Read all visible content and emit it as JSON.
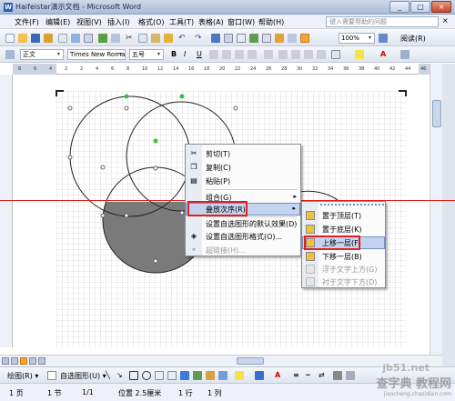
{
  "window": {
    "title": "Haifeistar演示文档 - Microsoft Word",
    "minimize": "_",
    "maximize": "□",
    "close": "×"
  },
  "menubar": {
    "items": [
      "文件(F)",
      "编辑(E)",
      "视图(V)",
      "插入(I)",
      "格式(O)",
      "工具(T)",
      "表格(A)",
      "窗口(W)",
      "帮助(H)"
    ],
    "help_placeholder": "键入需要帮助的问题"
  },
  "standard_toolbar": {
    "zoom": "100%",
    "read_label": "阅读(R)"
  },
  "formatting_toolbar": {
    "style": "正文",
    "font": "Times New Roman",
    "size": "五号"
  },
  "ruler_ticks": [
    "8",
    "6",
    "4",
    "2",
    "2",
    "4",
    "6",
    "8",
    "10",
    "12",
    "14",
    "16",
    "18",
    "20",
    "22",
    "24",
    "26",
    "28",
    "30",
    "32",
    "34",
    "36",
    "38",
    "40",
    "42",
    "44",
    "46"
  ],
  "context_menu": {
    "items": [
      {
        "label": "剪切(T)",
        "icon": "scissors-icon",
        "glyph": "✂",
        "disabled": false
      },
      {
        "label": "复制(C)",
        "icon": "copy-icon",
        "glyph": "❐",
        "disabled": false
      },
      {
        "label": "粘贴(P)",
        "icon": "paste-icon",
        "glyph": "▤",
        "disabled": false
      },
      {
        "label": "组合(G)",
        "icon": "",
        "glyph": "",
        "disabled": false,
        "submenu": "▸"
      },
      {
        "label": "叠放次序(R)",
        "icon": "",
        "glyph": "",
        "disabled": false,
        "submenu": "▸",
        "highlighted": true
      },
      {
        "label": "设置自选图形的默认效果(D)",
        "icon": "",
        "glyph": "",
        "disabled": false
      },
      {
        "label": "设置自选图形格式(O)...",
        "icon": "format-shape-icon",
        "glyph": "◈",
        "disabled": false
      },
      {
        "label": "超链接(H)...",
        "icon": "hyperlink-icon",
        "glyph": "⚭",
        "disabled": true
      }
    ]
  },
  "order_submenu": {
    "items": [
      {
        "label": "置于顶层(T)",
        "icon": "bring-to-front-icon",
        "disabled": false
      },
      {
        "label": "置于底层(K)",
        "icon": "send-to-back-icon",
        "disabled": false
      },
      {
        "label": "上移一层(F)",
        "icon": "bring-forward-icon",
        "disabled": false,
        "highlighted": true
      },
      {
        "label": "下移一层(B)",
        "icon": "send-backward-icon",
        "disabled": false
      },
      {
        "label": "浮于文字上方(G)",
        "icon": "in-front-of-text-icon",
        "disabled": true
      },
      {
        "label": "衬于文字下方(D)",
        "icon": "behind-text-icon",
        "disabled": true
      }
    ]
  },
  "drawing_toolbar": {
    "draw_label": "绘图(R) ▾",
    "autoshapes_label": "自选图形(U) ▾"
  },
  "status": {
    "page": "1 页",
    "section": "1 节",
    "pages": "1/1",
    "position": "位置 2.5厘米",
    "line": "1 行",
    "column": "1 列"
  },
  "watermark": {
    "site": "jb51.net",
    "brand": "查字典 教程网",
    "url": "jiaocheng.chazidian.com"
  },
  "colors": {
    "accent": "#6f8fc7",
    "highlight": "#c4d4ef",
    "red_marker": "#e02020",
    "shape_fill": "#7a7a7a"
  }
}
